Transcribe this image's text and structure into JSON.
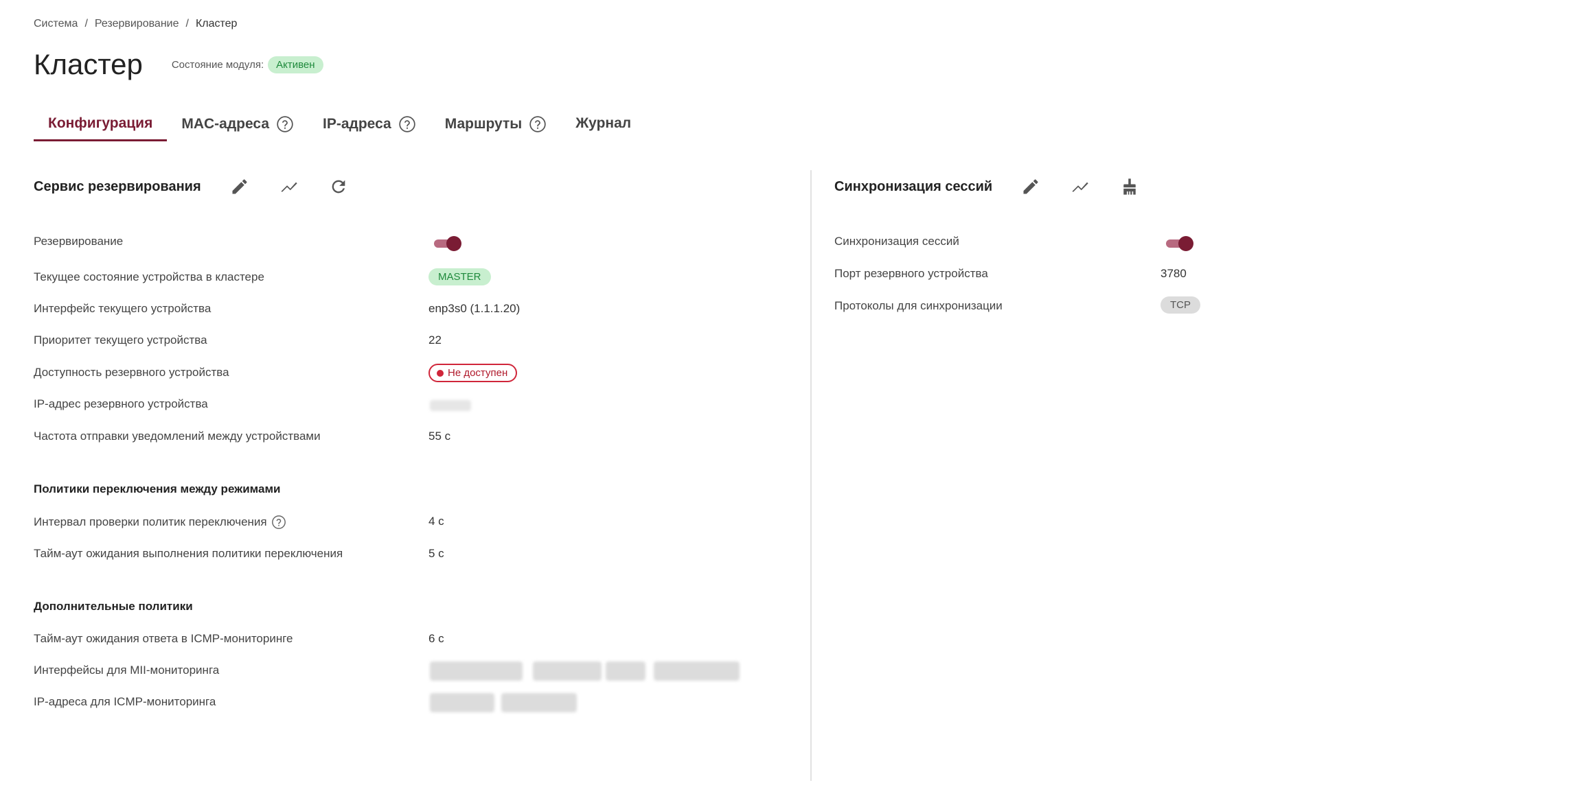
{
  "breadcrumb": [
    "Система",
    "Резервирование",
    "Кластер"
  ],
  "page": {
    "title": "Кластер",
    "module_state_label": "Состояние модуля:",
    "module_state": "Активен"
  },
  "tabs": [
    {
      "label": "Конфигурация",
      "active": true,
      "help": false
    },
    {
      "label": "MAC-адреса",
      "active": false,
      "help": true
    },
    {
      "label": "IP-адреса",
      "active": false,
      "help": true
    },
    {
      "label": "Маршруты",
      "active": false,
      "help": true
    },
    {
      "label": "Журнал",
      "active": false,
      "help": false
    }
  ],
  "left": {
    "title": "Сервис резервирования",
    "icons": [
      "edit-icon",
      "chart-icon",
      "refresh-icon"
    ],
    "rows": {
      "reservation": {
        "label": "Резервирование",
        "toggle": true
      },
      "state": {
        "label": "Текущее состояние устройства в кластере",
        "value": "MASTER"
      },
      "iface": {
        "label": "Интерфейс текущего устройства",
        "value": "enp3s0 (1.1.1.20)"
      },
      "priority": {
        "label": "Приоритет текущего устройства",
        "value": "22"
      },
      "availability": {
        "label": "Доступность резервного устройства",
        "value": "Не доступен"
      },
      "backup_ip": {
        "label": "IP-адрес резервного устройства"
      },
      "freq": {
        "label": "Частота отправки уведомлений между устройствами",
        "value": "55 с"
      }
    },
    "switch_policies": {
      "title": "Политики переключения между режимами",
      "interval": {
        "label": "Интервал проверки политик переключения",
        "value": "4 с"
      },
      "timeout": {
        "label": "Тайм-аут ожидания выполнения политики переключения",
        "value": "5 с"
      }
    },
    "extra_policies": {
      "title": "Дополнительные политики",
      "icmp_timeout": {
        "label": "Тайм-аут ожидания ответа в ICMP-мониторинге",
        "value": "6 с"
      },
      "mii": {
        "label": "Интерфейсы для MII-мониторинга"
      },
      "icmp_ips": {
        "label": "IP-адреса для ICMP-мониторинга"
      }
    }
  },
  "right": {
    "title": "Синхронизация сессий",
    "icons": [
      "edit-icon",
      "chart-icon",
      "broom-icon"
    ],
    "rows": {
      "sync": {
        "label": "Синхронизация сессий",
        "toggle": true
      },
      "port": {
        "label": "Порт резервного устройства",
        "value": "3780"
      },
      "protocols": {
        "label": "Протоколы для синхронизации",
        "value": "TCP"
      }
    }
  },
  "colors": {
    "accent": "#7a1c34",
    "success_bg": "#c8efcf",
    "success_text": "#1f8a3c",
    "error": "#d0263a"
  }
}
